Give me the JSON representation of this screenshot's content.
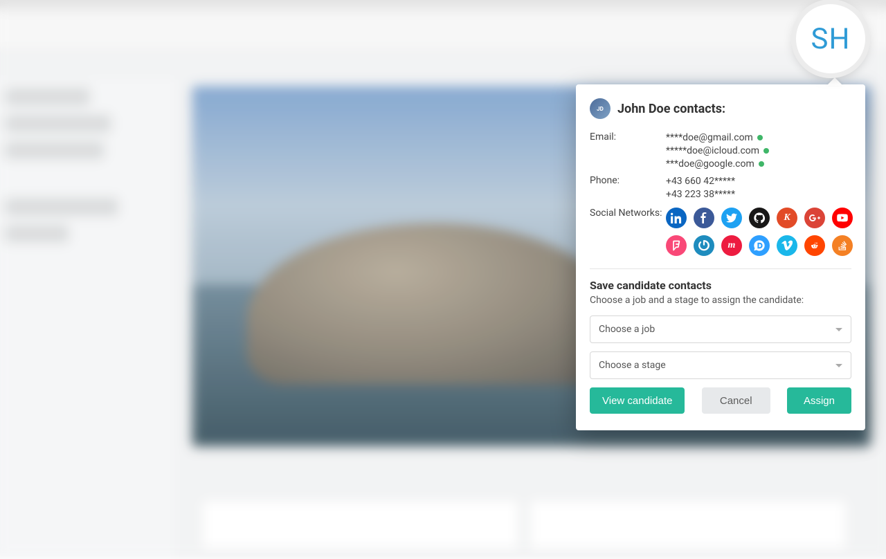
{
  "badge_text": "SH",
  "panel_title": "John Doe contacts:",
  "labels": {
    "email": "Email:",
    "phone": "Phone:",
    "social": "Social Networks:"
  },
  "emails": [
    "****doe@gmail.com",
    "*****doe@icloud.com",
    "***doe@google.com"
  ],
  "phones": [
    "+43 660 42*****",
    "+43 223 38*****"
  ],
  "social_networks": [
    {
      "name": "linkedin",
      "color": "#0a66c2"
    },
    {
      "name": "facebook",
      "color": "#3b5998"
    },
    {
      "name": "twitter",
      "color": "#1da1f2"
    },
    {
      "name": "github",
      "color": "#181717"
    },
    {
      "name": "klout",
      "color": "#e24b27"
    },
    {
      "name": "googleplus",
      "color": "#db4437"
    },
    {
      "name": "youtube",
      "color": "#ff0000"
    },
    {
      "name": "foursquare",
      "color": "#f94877"
    },
    {
      "name": "gravatar",
      "color": "#1e8cbe"
    },
    {
      "name": "meetup",
      "color": "#ed1c40"
    },
    {
      "name": "disqus",
      "color": "#2e9fff"
    },
    {
      "name": "vimeo",
      "color": "#1ab7ea"
    },
    {
      "name": "reddit",
      "color": "#ff4500"
    },
    {
      "name": "stackoverflow",
      "color": "#f48024"
    }
  ],
  "save": {
    "title": "Save candidate contacts",
    "subtitle": "Choose a job and a stage to assign the candidate:",
    "job_placeholder": "Choose a job",
    "stage_placeholder": "Choose a stage"
  },
  "buttons": {
    "view": "View candidate",
    "cancel": "Cancel",
    "assign": "Assign"
  }
}
